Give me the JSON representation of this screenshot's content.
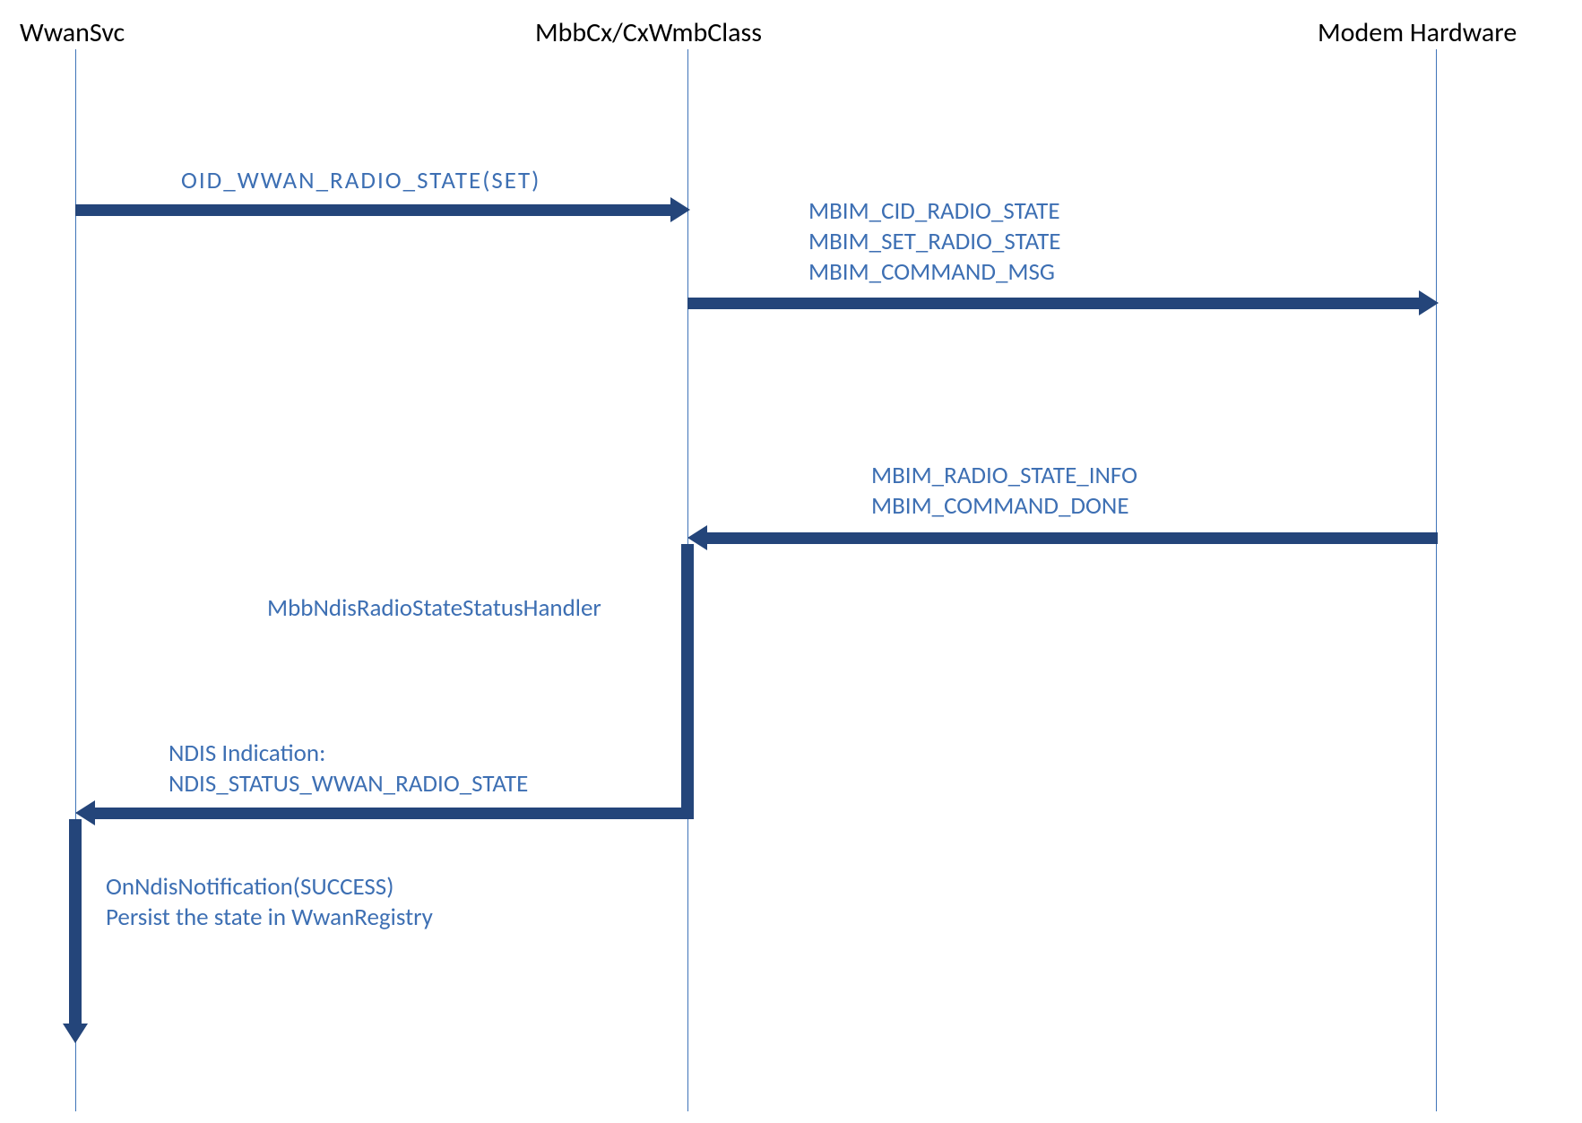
{
  "participants": {
    "a": "WwanSvc",
    "b": "MbbCx/CxWmbClass",
    "c": "Modem Hardware"
  },
  "messages": {
    "m1": "OID_WWAN_RADIO_STATE(SET)",
    "m2": "MBIM_CID_RADIO_STATE\nMBIM_SET_RADIO_STATE\nMBIM_COMMAND_MSG",
    "m3": "MBIM_RADIO_STATE_INFO\nMBIM_COMMAND_DONE",
    "m4": "MbbNdisRadioStateStatusHandler",
    "m5": "NDIS Indication:\nNDIS_STATUS_WWAN_RADIO_STATE",
    "m6": "OnNdisNotification(SUCCESS)\nPersist the state in WwanRegistry"
  },
  "colors": {
    "line": "#3f74b8",
    "arrow": "#24457a",
    "text": "#3d6fb3"
  }
}
